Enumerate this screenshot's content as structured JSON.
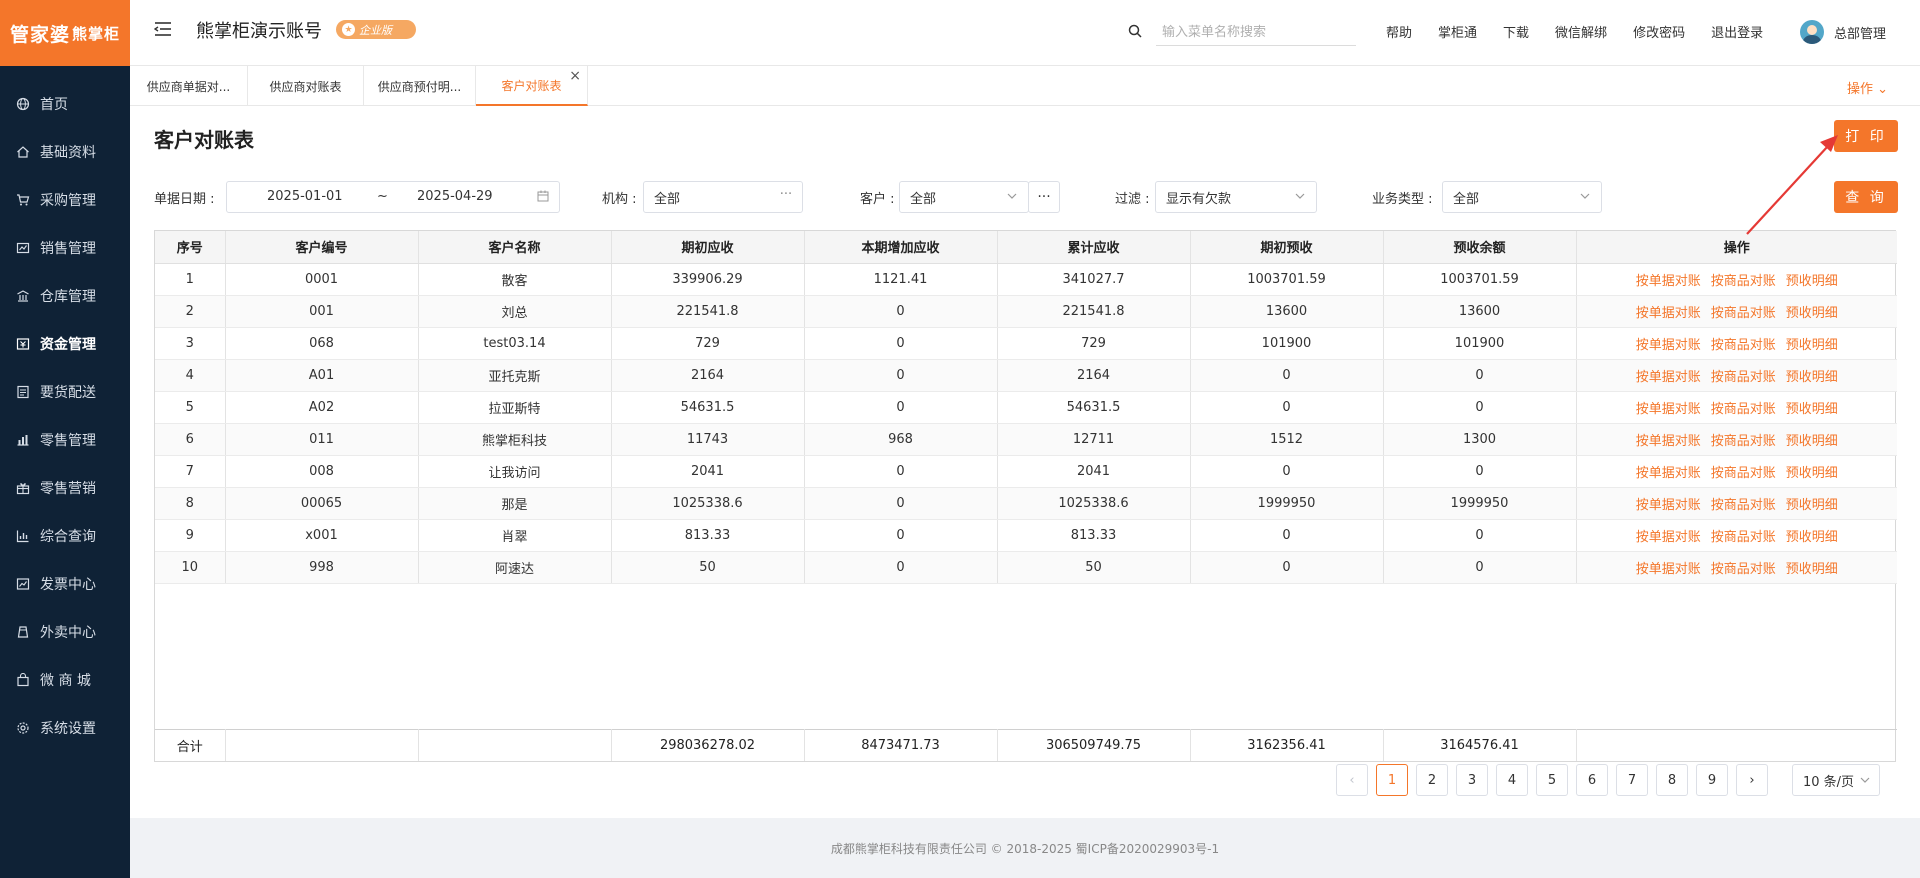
{
  "logo": {
    "main": "管家婆",
    "sub": "熊掌柜"
  },
  "sidebar": {
    "items": [
      {
        "label": "首页",
        "icon": "globe-icon",
        "active": false
      },
      {
        "label": "基础资料",
        "icon": "home-icon",
        "active": false
      },
      {
        "label": "采购管理",
        "icon": "cart-icon",
        "active": false
      },
      {
        "label": "销售管理",
        "icon": "sales-icon",
        "active": false
      },
      {
        "label": "仓库管理",
        "icon": "warehouse-icon",
        "active": false
      },
      {
        "label": "资金管理",
        "icon": "finance-icon",
        "active": true
      },
      {
        "label": "要货配送",
        "icon": "delivery-icon",
        "active": false
      },
      {
        "label": "零售管理",
        "icon": "retail-icon",
        "active": false
      },
      {
        "label": "零售营销",
        "icon": "gift-icon",
        "active": false
      },
      {
        "label": "综合查询",
        "icon": "chart-icon",
        "active": false
      },
      {
        "label": "发票中心",
        "icon": "invoice-icon",
        "active": false
      },
      {
        "label": "外卖中心",
        "icon": "takeout-icon",
        "active": false
      },
      {
        "label": "微 商 城",
        "icon": "shop-icon",
        "active": false
      },
      {
        "label": "系统设置",
        "icon": "gear-icon",
        "active": false
      }
    ]
  },
  "header": {
    "title": "熊掌柜演示账号",
    "badge": "企业版",
    "search_placeholder": "输入菜单名称搜索",
    "links": [
      "帮助",
      "掌柜通",
      "下载",
      "微信解绑",
      "修改密码",
      "退出登录"
    ],
    "user": "总部管理"
  },
  "tabs": {
    "items": [
      {
        "label": "供应商单据对...",
        "active": false
      },
      {
        "label": "供应商对账表",
        "active": false
      },
      {
        "label": "供应商预付明...",
        "active": false
      },
      {
        "label": "客户对账表",
        "active": true
      }
    ],
    "ops": "操作"
  },
  "page": {
    "title": "客户对账表",
    "print_label": "打 印",
    "query_label": "查 询"
  },
  "filters": {
    "date_label": "单据日期 :",
    "date_start": "2025-01-01",
    "date_sep": "~",
    "date_end": "2025-04-29",
    "org_label": "机构 :",
    "org_value": "全部",
    "customer_label": "客户 :",
    "customer_value": "全部",
    "filter_label": "过滤 :",
    "filter_value": "显示有欠款",
    "biz_label": "业务类型 :",
    "biz_value": "全部"
  },
  "table": {
    "columns": [
      "序号",
      "客户编号",
      "客户名称",
      "期初应收",
      "本期增加应收",
      "累计应收",
      "期初预收",
      "预收余额",
      "操作"
    ],
    "rows": [
      [
        "1",
        "0001",
        "散客",
        "339906.29",
        "1121.41",
        "341027.7",
        "1003701.59",
        "1003701.59"
      ],
      [
        "2",
        "001",
        "刘总",
        "221541.8",
        "0",
        "221541.8",
        "13600",
        "13600"
      ],
      [
        "3",
        "068",
        "test03.14",
        "729",
        "0",
        "729",
        "101900",
        "101900"
      ],
      [
        "4",
        "A01",
        "亚托克斯",
        "2164",
        "0",
        "2164",
        "0",
        "0"
      ],
      [
        "5",
        "A02",
        "拉亚斯特",
        "54631.5",
        "0",
        "54631.5",
        "0",
        "0"
      ],
      [
        "6",
        "011",
        "熊掌柜科技",
        "11743",
        "968",
        "12711",
        "1512",
        "1300"
      ],
      [
        "7",
        "008",
        "让我访问",
        "2041",
        "0",
        "2041",
        "0",
        "0"
      ],
      [
        "8",
        "00065",
        "那是",
        "1025338.6",
        "0",
        "1025338.6",
        "1999950",
        "1999950"
      ],
      [
        "9",
        "x001",
        "肖翠",
        "813.33",
        "0",
        "813.33",
        "0",
        "0"
      ],
      [
        "10",
        "998",
        "阿速达",
        "50",
        "0",
        "50",
        "0",
        "0"
      ]
    ],
    "ops": [
      "按单据对账",
      "按商品对账",
      "预收明细"
    ],
    "total": [
      "合计",
      "",
      "",
      "298036278.02",
      "8473471.73",
      "306509749.75",
      "3162356.41",
      "3164576.41",
      ""
    ]
  },
  "pagination": {
    "pages": [
      "1",
      "2",
      "3",
      "4",
      "5",
      "6",
      "7",
      "8",
      "9"
    ],
    "current": "1",
    "prev": "‹",
    "next": "›",
    "page_size": "10 条/页"
  },
  "footer": "成都熊掌柜科技有限责任公司 © 2018-2025 蜀ICP备2020029903号-1",
  "colors": {
    "accent": "#f4762a",
    "sidebar": "#0f2236",
    "annotation": "#e53935"
  }
}
